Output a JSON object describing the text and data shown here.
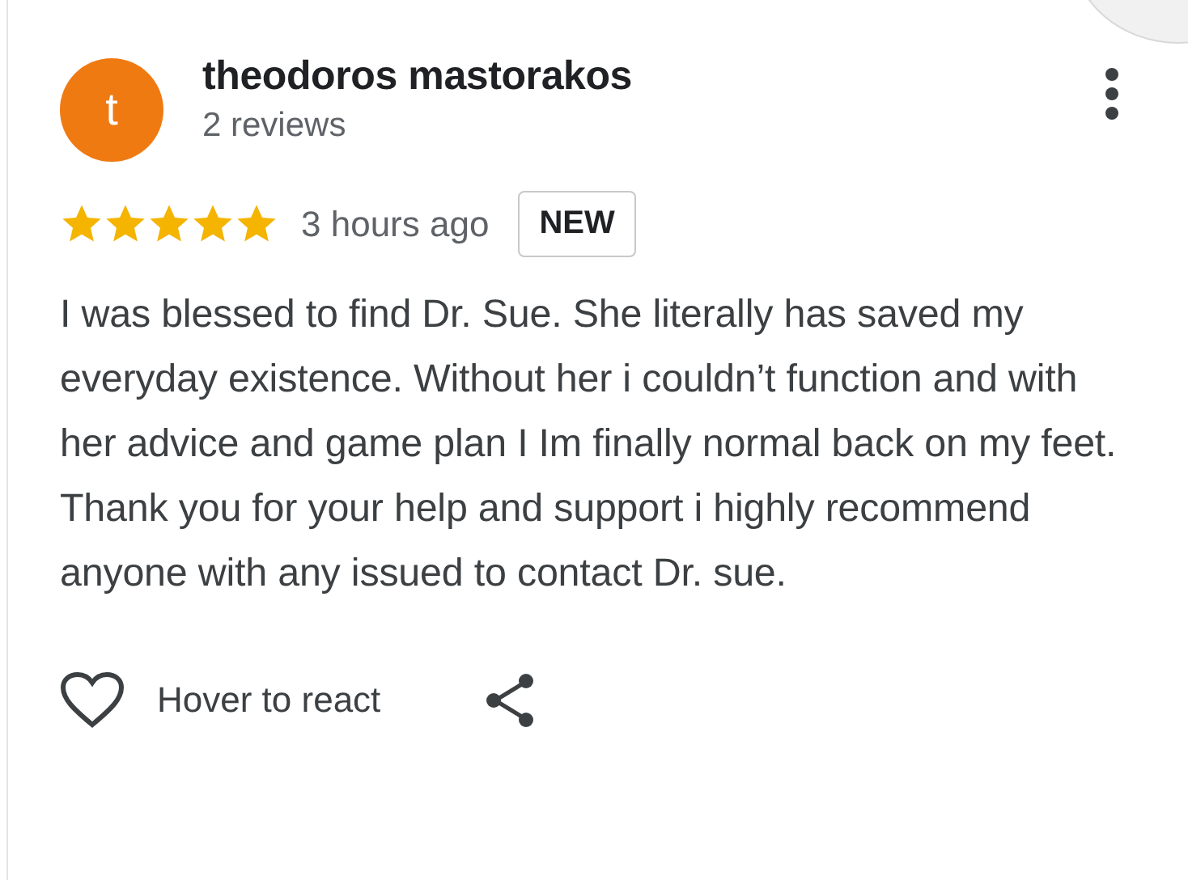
{
  "reviewer": {
    "avatar_letter": "t",
    "name": "theodoros mastorakos",
    "review_count": "2 reviews"
  },
  "review": {
    "stars": 5,
    "time": "3 hours ago",
    "badge": "NEW",
    "text": "I was blessed to find Dr. Sue. She literally has saved my everyday existence. Without her i couldn’t function and with her advice and game plan I Im finally normal back on my feet. Thank you for your help and support i highly recommend anyone with any issued to contact Dr. sue."
  },
  "actions": {
    "react_label": "Hover to react"
  }
}
